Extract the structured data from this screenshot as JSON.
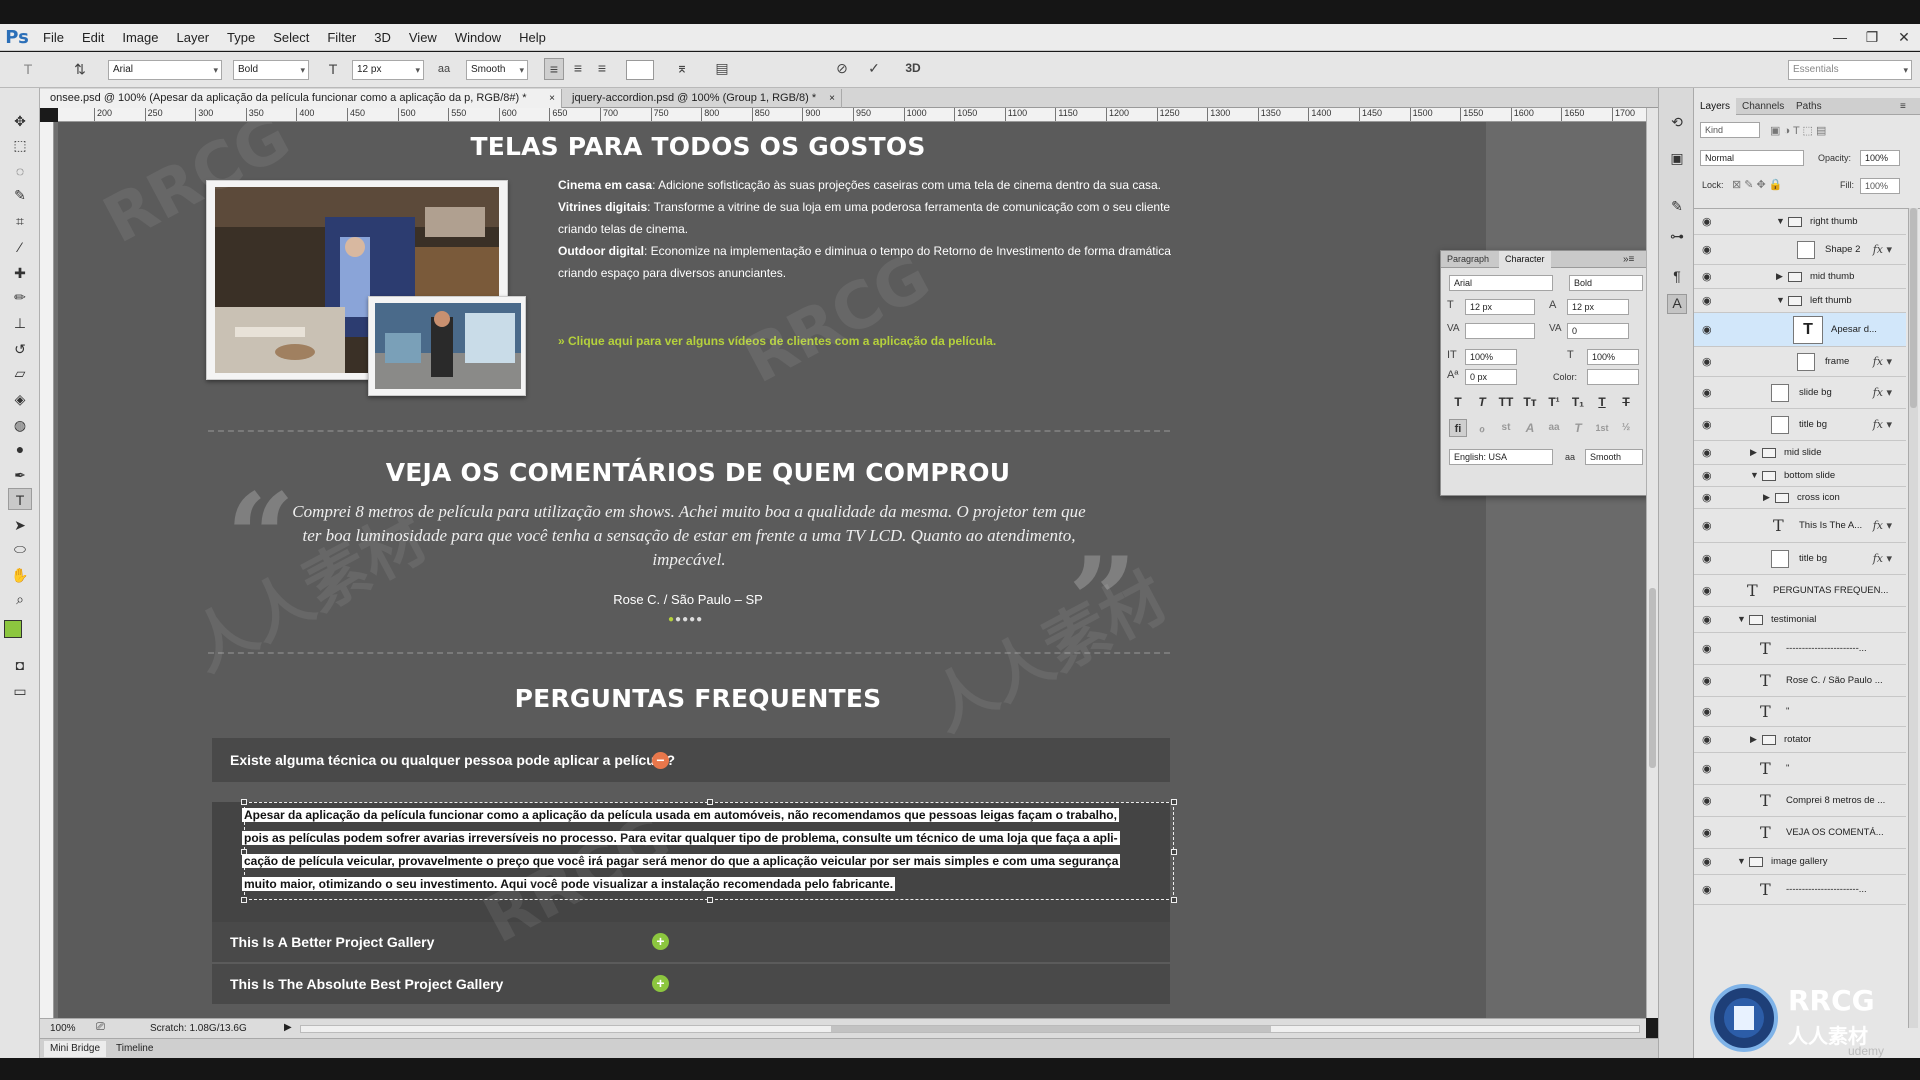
{
  "app": {
    "logo": "Ps",
    "menu": [
      "File",
      "Edit",
      "Image",
      "Layer",
      "Type",
      "Select",
      "Filter",
      "3D",
      "View",
      "Window",
      "Help"
    ],
    "window_controls": [
      "—",
      "❐",
      "✕"
    ]
  },
  "options_bar": {
    "font_family": "Arial",
    "font_style": "Bold",
    "font_size": "12 px",
    "antialias_label": "aa",
    "antialias": "Smooth",
    "workspace": "Essentials"
  },
  "tabs": [
    {
      "label": "onsee.psd @ 100% (Apesar da aplicação da película funcionar como a aplicação da p, RGB/8#) *",
      "active": true
    },
    {
      "label": "jquery-accordion.psd @ 100% (Group 1, RGB/8) *",
      "active": false
    }
  ],
  "ruler": [
    "200",
    "250",
    "300",
    "350",
    "400",
    "450",
    "500",
    "550",
    "600",
    "650",
    "700",
    "750",
    "800",
    "850",
    "900",
    "950",
    "1000",
    "1050",
    "1100",
    "1150",
    "1200",
    "1250",
    "1300",
    "1350",
    "1400",
    "1450",
    "1500",
    "1550",
    "1600",
    "1650",
    "1700"
  ],
  "canvas": {
    "section1_title": "TELAS PARA TODOS OS GOSTOS",
    "features": [
      {
        "bold": "Cinema em casa",
        "text": ": Adicione sofisticação às suas projeções caseiras com uma tela de cinema dentro da sua casa."
      },
      {
        "bold": "Vitrines digitais",
        "text": ": Transforme a vitrine de sua loja em uma poderosa ferramenta de comunicação com o seu cliente criando telas de cinema."
      },
      {
        "bold": "Outdoor digital",
        "text": ": Economize na implementação e diminua o tempo do Retorno de Investimento de forma dramática criando espaço para diversos anunciantes."
      }
    ],
    "feature_link": "» Clique aqui para ver alguns vídeos de clientes com a aplicação da película.",
    "section2_title": "VEJA OS COMENTÁRIOS DE QUEM COMPROU",
    "testimonial": "Comprei 8 metros de película para utilização em shows. Achei muito boa a qualidade da mesma. O projetor tem que ter boa luminosidade para que você tenha a sensação de estar em frente a uma TV LCD. Quanto ao atendimento, impecável.",
    "testimonial_author": "Rose C. / São Paulo – SP",
    "quote_open": "“",
    "quote_close": "”",
    "section3_title": "PERGUNTAS FREQUENTES",
    "faq": [
      {
        "question": "Existe alguma técnica ou qualquer pessoa pode aplicar a película?",
        "icon": "minus-icon",
        "expanded": true
      },
      {
        "question": "This Is A Better Project Gallery",
        "icon": "plus-icon",
        "expanded": false
      },
      {
        "question": "This Is The Absolute Best Project Gallery",
        "icon": "plus-icon",
        "expanded": false
      }
    ],
    "faq_answer_lines": [
      "Apesar da aplicação da película funcionar como a aplicação da película usada em automóveis, não recomendamos que pessoas leigas façam o trabalho,",
      "pois as películas podem sofrer avarias irreversíveis no processo. Para evitar qualquer tipo de problema, consulte um técnico de uma loja que faça a apli-",
      "cação de película veicular, provavelmente o preço que você irá pagar será menor do que a aplicação veicular por ser mais simples e com uma segurança",
      "muito maior, otimizando o seu investimento. Aqui você pode visualizar a instalação recomendada pelo fabricante."
    ]
  },
  "character_panel": {
    "tabs": [
      "Paragraph",
      "Character"
    ],
    "font_family": "Arial",
    "font_style": "Bold",
    "font_size": "12 px",
    "leading": "12 px",
    "kerning": "",
    "tracking": "0",
    "vscale": "100%",
    "hscale": "100%",
    "baseline": "0 px",
    "color_label": "Color:",
    "language": "English: USA",
    "aa_label": "aa",
    "antialias": "Smooth",
    "style_buttons": [
      "T",
      "T",
      "TT",
      "Tт",
      "T¹",
      "T₁",
      "T",
      "T"
    ],
    "ot_buttons": [
      "fi",
      "ℴ",
      "st",
      "A",
      "aa",
      "T",
      "1st",
      "½"
    ]
  },
  "layers_panel": {
    "tabs": [
      "Layers",
      "Channels",
      "Paths"
    ],
    "kind": "Kind",
    "blend_mode": "Normal",
    "opacity_label": "Opacity:",
    "opacity": "100%",
    "lock_label": "Lock:",
    "fill_label": "Fill:",
    "fill": "100%",
    "rows": [
      {
        "name": "right thumb",
        "type": "group",
        "indent": 4,
        "open": true,
        "fx": false,
        "selected": false
      },
      {
        "name": "Shape 2",
        "type": "shape",
        "indent": 5,
        "open": false,
        "fx": true,
        "selected": false
      },
      {
        "name": "mid thumb",
        "type": "group",
        "indent": 4,
        "open": false,
        "fx": false,
        "selected": false
      },
      {
        "name": "left thumb",
        "type": "group",
        "indent": 4,
        "open": true,
        "fx": false,
        "selected": false
      },
      {
        "name": "Apesar d...",
        "type": "text",
        "indent": 5,
        "open": false,
        "fx": false,
        "selected": true
      },
      {
        "name": "frame",
        "type": "shape",
        "indent": 5,
        "open": false,
        "fx": true,
        "selected": false
      },
      {
        "name": "slide bg",
        "type": "shape",
        "indent": 3,
        "open": false,
        "fx": true,
        "selected": false
      },
      {
        "name": "title bg",
        "type": "shape",
        "indent": 3,
        "open": false,
        "fx": true,
        "selected": false
      },
      {
        "name": "mid slide",
        "type": "group",
        "indent": 2,
        "open": false,
        "fx": false,
        "selected": false
      },
      {
        "name": "bottom slide",
        "type": "group",
        "indent": 2,
        "open": true,
        "fx": false,
        "selected": false
      },
      {
        "name": "cross icon",
        "type": "group",
        "indent": 3,
        "open": false,
        "fx": false,
        "selected": false
      },
      {
        "name": "This Is The A...",
        "type": "text",
        "indent": 3,
        "open": false,
        "fx": true,
        "selected": false
      },
      {
        "name": "title bg",
        "type": "shape",
        "indent": 3,
        "open": false,
        "fx": true,
        "selected": false
      },
      {
        "name": "PERGUNTAS FREQUEN...",
        "type": "text",
        "indent": 1,
        "open": false,
        "fx": false,
        "selected": false
      },
      {
        "name": "testimonial",
        "type": "group",
        "indent": 1,
        "open": true,
        "fx": false,
        "selected": false
      },
      {
        "name": "-----------------------...",
        "type": "text",
        "indent": 2,
        "open": false,
        "fx": false,
        "selected": false
      },
      {
        "name": "Rose C. / São Paulo ...",
        "type": "text",
        "indent": 2,
        "open": false,
        "fx": false,
        "selected": false
      },
      {
        "name": "\"",
        "type": "text",
        "indent": 2,
        "open": false,
        "fx": false,
        "selected": false
      },
      {
        "name": "rotator",
        "type": "group",
        "indent": 2,
        "open": false,
        "fx": false,
        "selected": false
      },
      {
        "name": "\"",
        "type": "text",
        "indent": 2,
        "open": false,
        "fx": false,
        "selected": false
      },
      {
        "name": "Comprei 8 metros de ...",
        "type": "text",
        "indent": 2,
        "open": false,
        "fx": false,
        "selected": false
      },
      {
        "name": "VEJA OS COMENTÁ...",
        "type": "text",
        "indent": 2,
        "open": false,
        "fx": false,
        "selected": false
      },
      {
        "name": "image gallery",
        "type": "group",
        "indent": 1,
        "open": true,
        "fx": false,
        "selected": false
      },
      {
        "name": "-----------------------...",
        "type": "text",
        "indent": 2,
        "open": false,
        "fx": false,
        "selected": false
      }
    ]
  },
  "status": {
    "zoom": "100%",
    "scratch": "Scratch: 1.08G/13.6G"
  },
  "bottom_tabs": [
    "Mini Bridge",
    "Timeline"
  ],
  "watermark": "RRCG",
  "watermark_cjk": "人人素材",
  "corner_logo": {
    "title": "RRCG",
    "subtitle": "人人素材",
    "caption": "udemy"
  },
  "colors": {
    "accent_green": "#8cc63f",
    "link_green": "#b5d13c",
    "minus_orange": "#e8774b",
    "selected_layer": "#d2e7fa"
  }
}
